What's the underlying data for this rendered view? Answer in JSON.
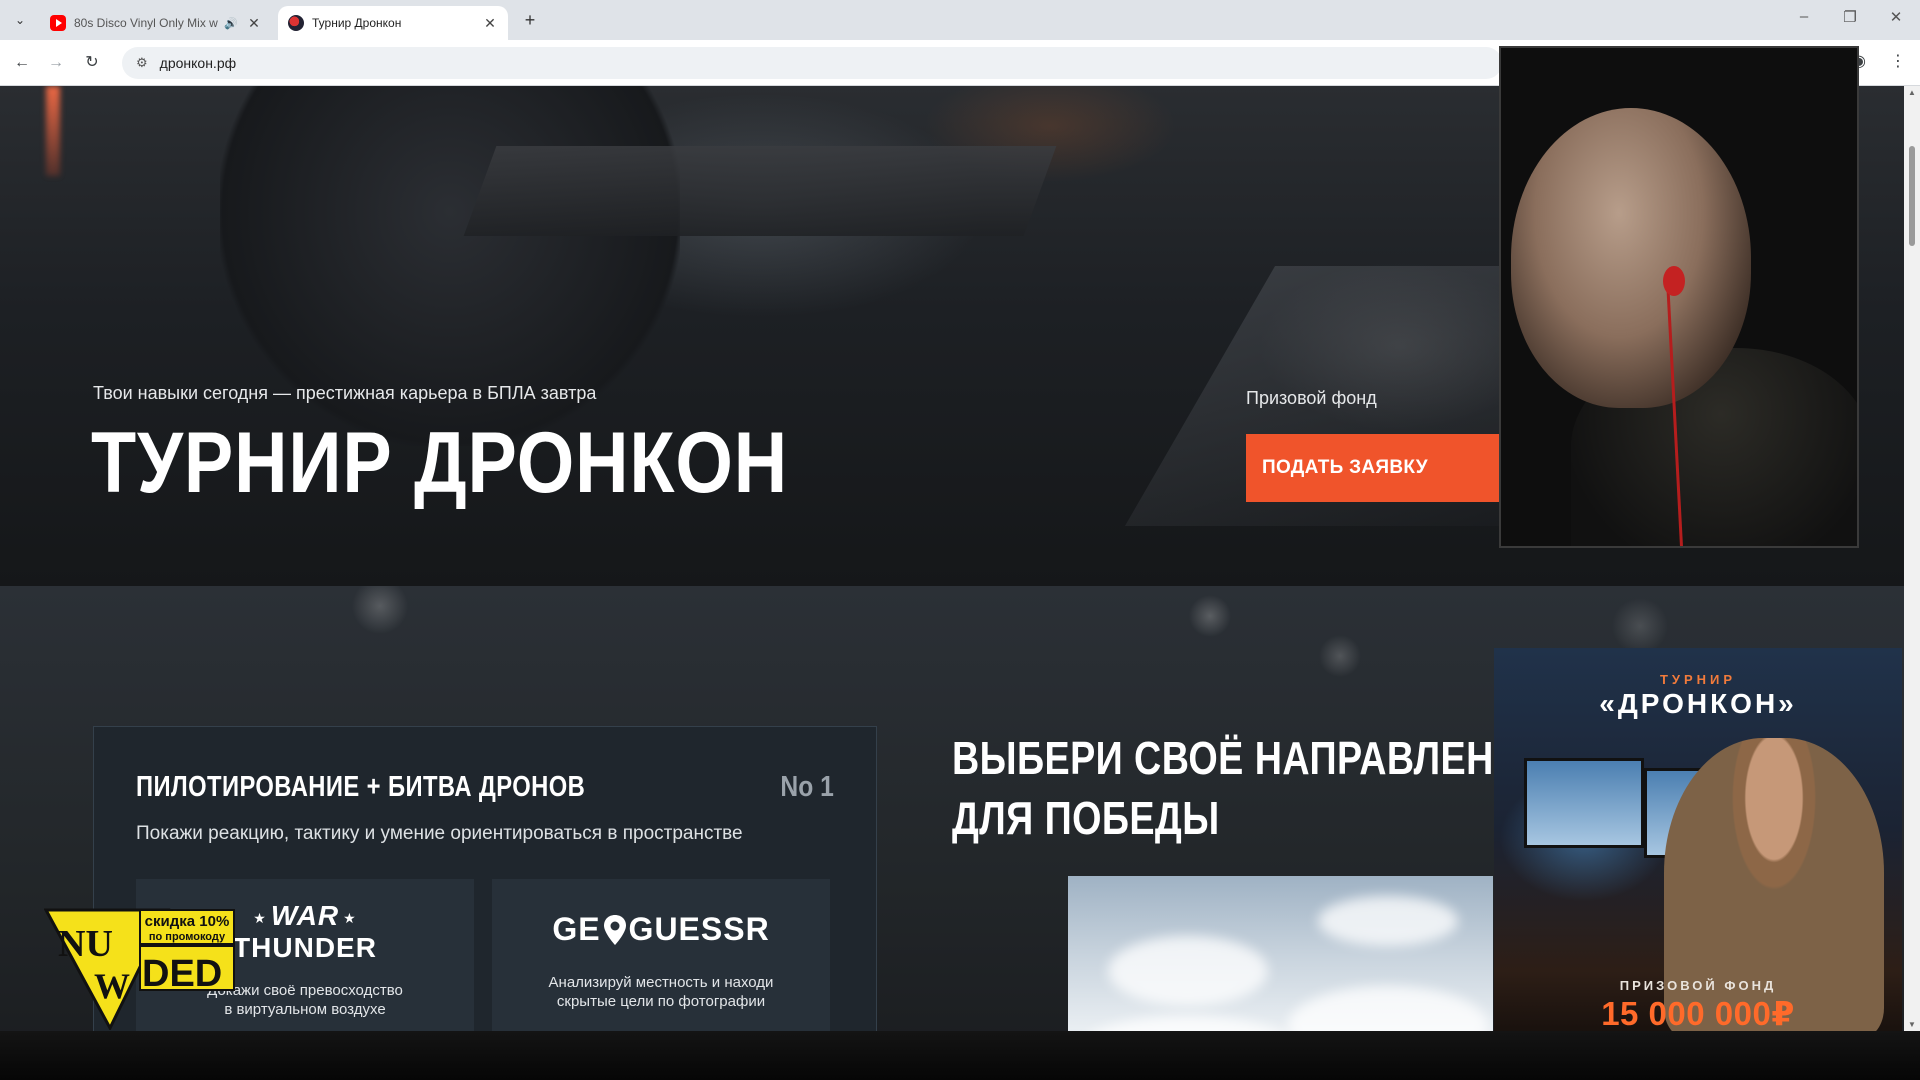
{
  "browser": {
    "tabs": [
      {
        "title": "80s Disco Vinyl Only Mix w",
        "icon": "youtube-icon",
        "audio": true
      },
      {
        "title": "Турнир Дронкон",
        "icon": "dronkon-icon",
        "audio": false
      }
    ],
    "address": "дронкон.рф"
  },
  "hero": {
    "subtitle": "Твои навыки сегодня — престижная карьера в БПЛА завтра",
    "title": "ТУРНИР ДРОНКОН",
    "prize_label": "Призовой фонд",
    "apply_button": "ПОДАТЬ ЗАЯВКУ"
  },
  "directions": {
    "heading_line1": "ВЫБЕРИ СВОЁ НАПРАВЛЕНИЕ",
    "heading_line2": "ДЛЯ ПОБЕДЫ",
    "card": {
      "title": "ПИЛОТИРОВАНИЕ + БИТВА ДРОНОВ",
      "number": "No 1",
      "description": "Покажи реакцию, тактику и умение ориентироваться в пространстве",
      "games": [
        {
          "logo_line1": "WAR",
          "logo_line2": "THUNDER",
          "description_line1": "Докажи своё превосходство",
          "description_line2": "в виртуальном воздухе"
        },
        {
          "logo_left": "GE",
          "logo_right": "GUESSR",
          "description_line1": "Анализируй местность и находи",
          "description_line2": "скрытые цели по фотографии"
        }
      ]
    }
  },
  "sticker": {
    "line1": "NU",
    "line2": "DED",
    "line3": "W",
    "promo_line1": "скидка 10%",
    "promo_line2": "по промокоду"
  },
  "prize_ad": {
    "small": "ТУРНИР",
    "big": "«ДРОНКОН»",
    "fund_label": "ПРИЗОВОЙ ФОНД",
    "fund_value": "15 000 000₽"
  },
  "colors": {
    "accent": "#f0542b",
    "prize_value": "#ff6a2a",
    "sticker_yellow": "#f5e11a"
  }
}
